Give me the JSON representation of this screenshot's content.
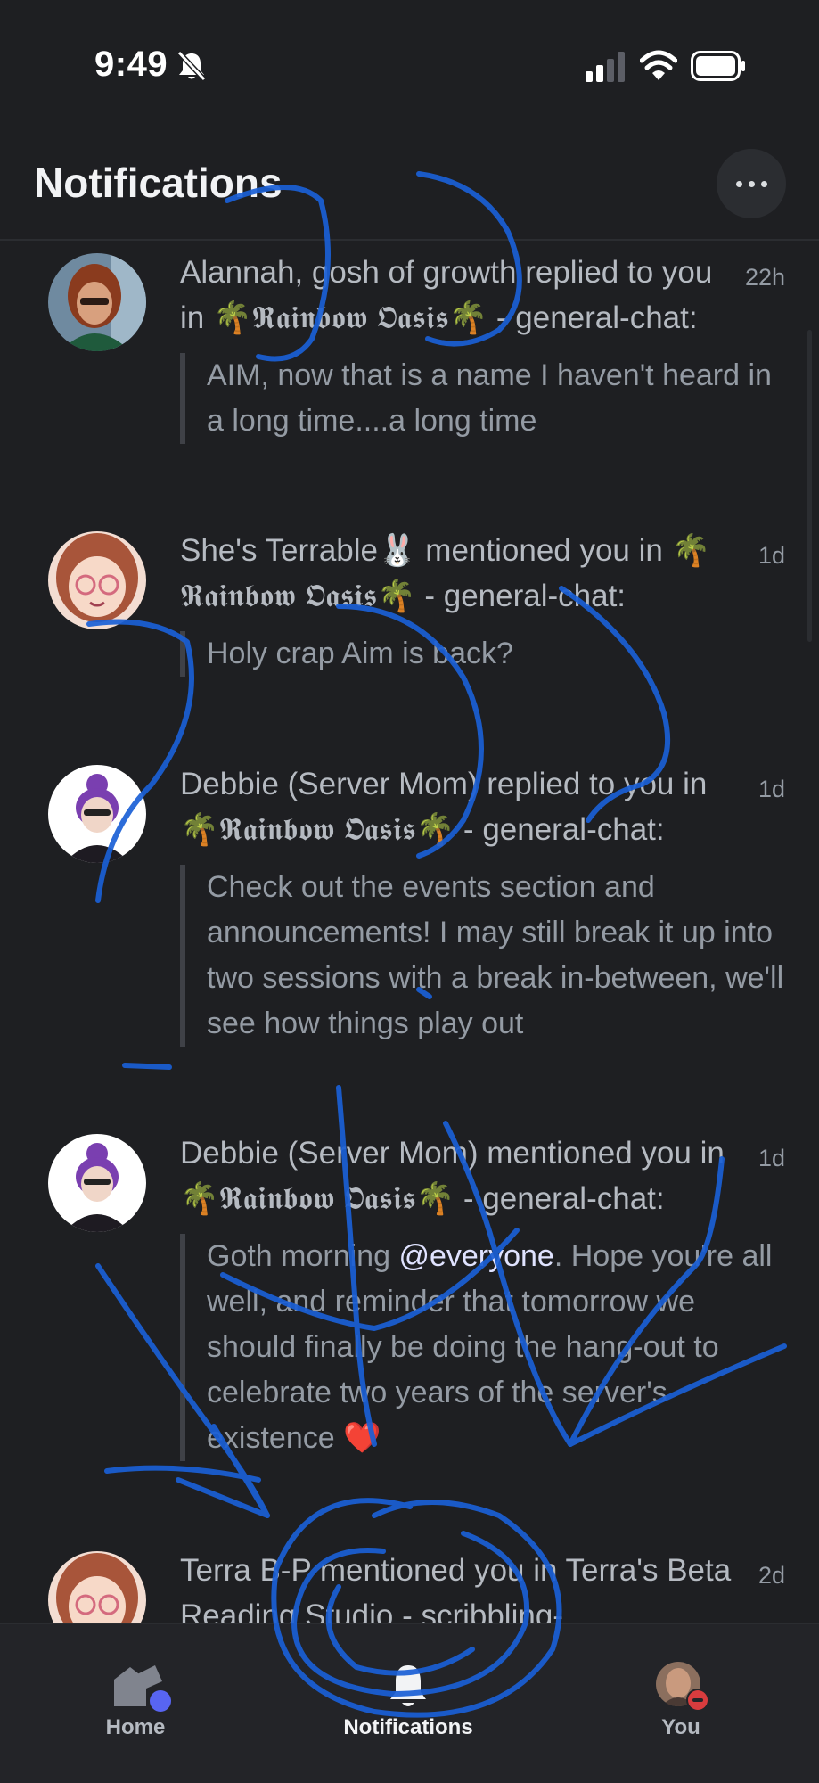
{
  "status_bar": {
    "time": "9:49"
  },
  "header": {
    "title": "Notifications"
  },
  "notifications": [
    {
      "text": "Alannah, gosh of growth replied to you in 🌴𝕽𝖆𝖎𝖓𝖇𝖔𝖜 𝕺𝖆𝖘𝖎𝖘🌴 - general-chat:",
      "time": "22h",
      "quote": "AIM, now that is a name I haven't heard in a long time....a long time"
    },
    {
      "text": "She's Terrable🐰 mentioned you in 🌴𝕽𝖆𝖎𝖓𝖇𝖔𝖜 𝕺𝖆𝖘𝖎𝖘🌴 - general-chat:",
      "time": "1d",
      "quote": "Holy crap Aim is back?"
    },
    {
      "text": "Debbie (Server Mom) replied to you in 🌴𝕽𝖆𝖎𝖓𝖇𝖔𝖜 𝕺𝖆𝖘𝖎𝖘🌴 - general-chat:",
      "time": "1d",
      "quote": "Check out the events section and announcements! I may still break it up into two sessions with a break in-between, we'll see how things play out"
    },
    {
      "text": "Debbie (Server Mom) mentioned you in 🌴𝕽𝖆𝖎𝖓𝖇𝖔𝖜 𝕺𝖆𝖘𝖎𝖘🌴 - general-chat:",
      "time": "1d",
      "quote_before": "Goth morning ",
      "quote_mention": "@everyone",
      "quote_after": ". Hope you're all well, and reminder that tomorrow we should finally be doing the hang-out to celebrate two years of the server's existence ",
      "quote_heart": "❤️"
    },
    {
      "text": "Terra B-P mentioned you in Terra's Beta Reading Studio - scribbling-",
      "time": "2d"
    }
  ],
  "bottom_nav": {
    "home": "Home",
    "notifications": "Notifications",
    "you": "You"
  },
  "colors": {
    "background": "#1e1f22",
    "nav_background": "#232428",
    "scribble": "#1a5fd6",
    "home_badge": "#5865f2",
    "dnd": "#d83c3e"
  }
}
